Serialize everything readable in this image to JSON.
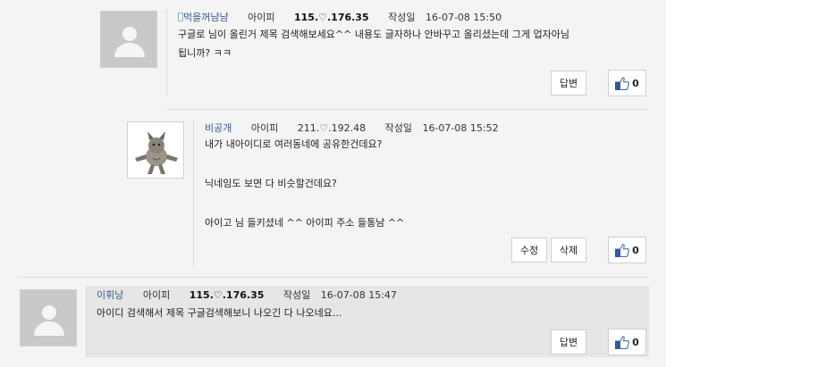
{
  "comments": [
    {
      "nick": "먹을꺼냠냠",
      "ip_label": "아이피",
      "ip": "115.♡.176.35",
      "date_label": "작성일",
      "date": "16-07-08 15:50",
      "lines": [
        "구글로 님이 올린거 제목 검색해보세요^^ 내용도 글자하나 안바꾸고 올리셨는데 그게 업자아님",
        "됩니까? ㅋㅋ"
      ],
      "reply_label": "답변",
      "likes": "0"
    },
    {
      "nick": "비공개",
      "ip_label": "아이피",
      "ip": "211.♡.192.48",
      "date_label": "작성일",
      "date": "16-07-08 15:52",
      "lines": [
        "내가 내아이디로 여러동네에 공유한건데요?",
        "닉네임도 보면 다 비슷할건데요?",
        "아이고 님 들키셨네 ^^ 아이피 주소 들통남 ^^"
      ],
      "edit_label": "수정",
      "delete_label": "삭제",
      "likes": "0"
    },
    {
      "nick": "이휘낭",
      "ip_label": "아이피",
      "ip": "115.♡.176.35",
      "date_label": "작성일",
      "date": "16-07-08 15:47",
      "lines": [
        "아이디 검색해서 제목 구글검색해보니 나오긴 다 나오네요..."
      ],
      "reply_label": "답변",
      "likes": "0"
    }
  ],
  "icons": {
    "avatar": "user-silhouette-icon",
    "avatar_photo": "cat-avatar-icon",
    "like": "thumbs-up-icon",
    "mobile": "mobile-phone-icon"
  },
  "colors": {
    "nick": "#3a5a8a",
    "panel": "#f4f4f4",
    "highlight_row": "#e6e6e6"
  }
}
